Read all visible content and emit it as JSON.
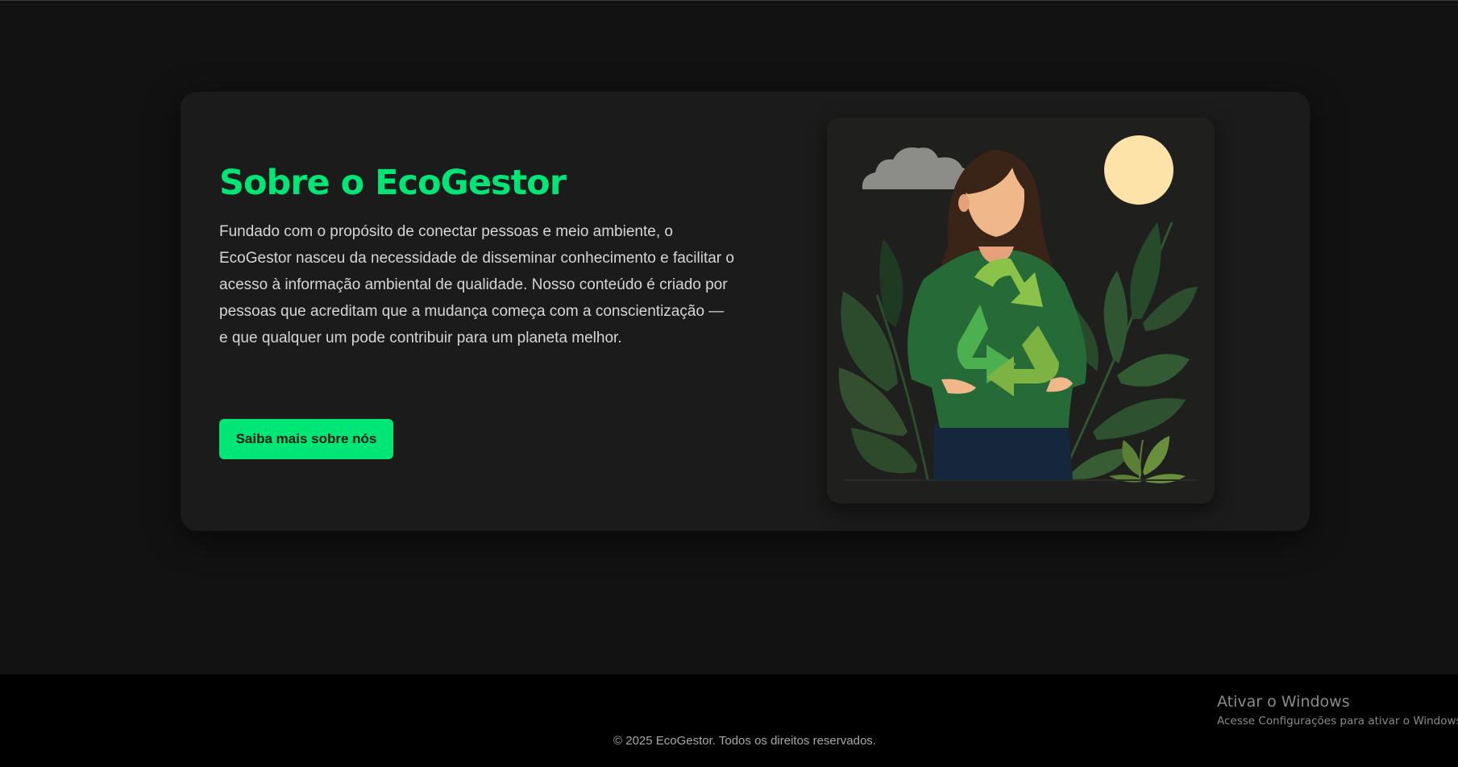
{
  "about": {
    "title": "Sobre o EcoGestor",
    "description": "Fundado com o propósito de conectar pessoas e meio ambiente, o EcoGestor nasceu da necessidade de disseminar conhecimento e facilitar o acesso à informação ambiental de qualidade. Nosso conteúdo é criado por pessoas que acreditam que a mudança começa com a conscientização — e que qualquer um pode contribuir para um planeta melhor.",
    "cta_label": "Saiba mais sobre nós",
    "illustration": {
      "icon": "person-holding-recycle-symbol-illustration",
      "accent_color": "#00e676"
    }
  },
  "footer": {
    "copyright": "© 2025 EcoGestor. Todos os direitos reservados."
  },
  "windows_watermark": {
    "title": "Ativar o Windows",
    "subtitle": "Acesse Configurações para ativar o Windows."
  },
  "colors": {
    "background": "#121212",
    "card": "#1b1b1b",
    "accent": "#00e676",
    "footer": "#000000"
  }
}
